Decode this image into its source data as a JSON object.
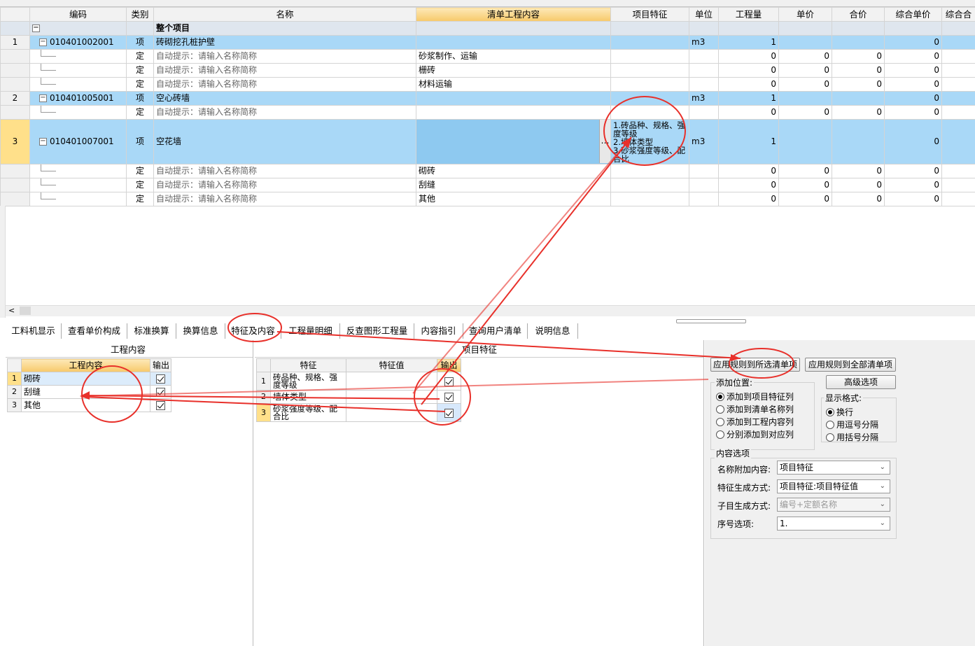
{
  "grid": {
    "columns": [
      "编码",
      "类别",
      "名称",
      "清单工程内容",
      "项目特征",
      "单位",
      "工程量",
      "单价",
      "合价",
      "综合单价",
      "综合合"
    ],
    "summary_label": "整个项目",
    "rows": [
      {
        "rn": "1",
        "code": "010401002001",
        "cat": "项",
        "name": "砖砌挖孔桩护壁",
        "content": "",
        "feature": "",
        "unit": "m3",
        "qty": "1",
        "price": "",
        "total": "",
        "cu": "0"
      },
      {
        "rn": "",
        "code": "",
        "cat": "定",
        "name": "自动提示：请输入名称简称",
        "content": "砂浆制作、运输",
        "feature": "",
        "unit": "",
        "qty": "0",
        "price": "0",
        "total": "0",
        "cu": "0"
      },
      {
        "rn": "",
        "code": "",
        "cat": "定",
        "name": "自动提示：请输入名称简称",
        "content": "栅砖",
        "feature": "",
        "unit": "",
        "qty": "0",
        "price": "0",
        "total": "0",
        "cu": "0"
      },
      {
        "rn": "",
        "code": "",
        "cat": "定",
        "name": "自动提示：请输入名称简称",
        "content": "材料运输",
        "feature": "",
        "unit": "",
        "qty": "0",
        "price": "0",
        "total": "0",
        "cu": "0"
      },
      {
        "rn": "2",
        "code": "010401005001",
        "cat": "项",
        "name": "空心砖墙",
        "content": "",
        "feature": "",
        "unit": "m3",
        "qty": "1",
        "price": "",
        "total": "",
        "cu": "0"
      },
      {
        "rn": "",
        "code": "",
        "cat": "定",
        "name": "自动提示：请输入名称简称",
        "content": "",
        "feature": "",
        "unit": "",
        "qty": "0",
        "price": "0",
        "total": "0",
        "cu": "0"
      },
      {
        "rn": "3",
        "code": "010401007001",
        "cat": "项",
        "name": "空花墙",
        "content": "",
        "feature": "1.砖品种、规格、强度等级\n2.墙体类型\n3.砂浆强度等级、配合比",
        "unit": "m3",
        "qty": "1",
        "price": "",
        "total": "",
        "cu": "0"
      },
      {
        "rn": "",
        "code": "",
        "cat": "定",
        "name": "自动提示：请输入名称简称",
        "content": "砌砖",
        "feature": "",
        "unit": "",
        "qty": "0",
        "price": "0",
        "total": "0",
        "cu": "0"
      },
      {
        "rn": "",
        "code": "",
        "cat": "定",
        "name": "自动提示：请输入名称简称",
        "content": "刮缝",
        "feature": "",
        "unit": "",
        "qty": "0",
        "price": "0",
        "total": "0",
        "cu": "0"
      },
      {
        "rn": "",
        "code": "",
        "cat": "定",
        "name": "自动提示：请输入名称简称",
        "content": "其他",
        "feature": "",
        "unit": "",
        "qty": "0",
        "price": "0",
        "total": "0",
        "cu": "0"
      }
    ]
  },
  "ellipsis": "…",
  "scroll_left": "<",
  "tabs": [
    "工料机显示",
    "查看单价构成",
    "标准换算",
    "换算信息",
    "特征及内容",
    "工程量明细",
    "反查图形工程量",
    "内容指引",
    "查询用户清单",
    "说明信息"
  ],
  "left_panel": {
    "title": "工程内容",
    "col_content": "工程内容",
    "col_output": "输出",
    "rows": [
      {
        "rn": "1",
        "text": "砌砖"
      },
      {
        "rn": "2",
        "text": "刮缝"
      },
      {
        "rn": "3",
        "text": "其他"
      }
    ]
  },
  "mid_panel": {
    "title": "项目特征",
    "col_feature": "特征",
    "col_value": "特征值",
    "col_output": "输出",
    "rows": [
      {
        "rn": "1",
        "text": "砖品种、规格、强度等级"
      },
      {
        "rn": "2",
        "text": "墙体类型"
      },
      {
        "rn": "3",
        "text": "砂浆强度等级、配合比"
      }
    ]
  },
  "right_panel": {
    "btn_apply_selected": "应用规则到所选清单项",
    "btn_apply_all": "应用规则到全部清单项",
    "btn_advanced": "高级选项",
    "add_position_label": "添加位置:",
    "add_position_options": [
      "添加到项目特征列",
      "添加到清单名称列",
      "添加到工程内容列",
      "分别添加到对应列"
    ],
    "display_format_label": "显示格式:",
    "display_format_options": [
      "换行",
      "用逗号分隔",
      "用括号分隔"
    ],
    "content_options_label": "内容选项",
    "name_append_label": "名称附加内容:",
    "name_append_value": "项目特征",
    "feature_gen_label": "特征生成方式:",
    "feature_gen_value": "项目特征:项目特征值",
    "sub_gen_label": "子目生成方式:",
    "sub_gen_value": "编号+定额名称",
    "seq_label": "序号选项:",
    "seq_value": "1."
  },
  "colors": {
    "highlight_row": "#a9d8f7",
    "header_accent": "#f7c96a",
    "annotation": "#e8302a"
  }
}
